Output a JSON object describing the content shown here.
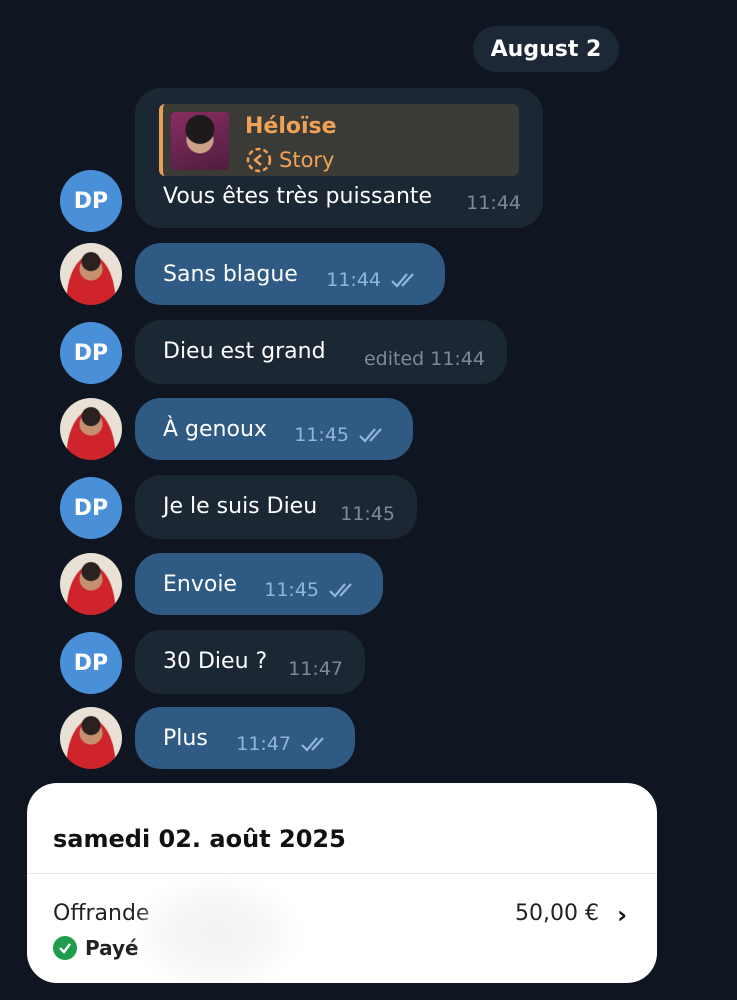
{
  "chat": {
    "date_pill": "August 2",
    "reply": {
      "name": "Héloïse",
      "label": "Story"
    },
    "messages": [
      {
        "sender": "DP",
        "text": "Vous êtes très puissante",
        "time": "11:44",
        "outgoing": false
      },
      {
        "sender": "me",
        "text": "Sans blague",
        "time": "11:44",
        "outgoing": true
      },
      {
        "sender": "DP",
        "text": "Dieu est grand",
        "time": "edited 11:44",
        "outgoing": false
      },
      {
        "sender": "me",
        "text": "À genoux",
        "time": "11:45",
        "outgoing": true
      },
      {
        "sender": "DP",
        "text": "Je le suis Dieu",
        "time": "11:45",
        "outgoing": false
      },
      {
        "sender": "me",
        "text": "Envoie",
        "time": "11:45",
        "outgoing": true
      },
      {
        "sender": "DP",
        "text": "30 Dieu ?",
        "time": "11:47",
        "outgoing": false
      },
      {
        "sender": "me",
        "text": "Plus",
        "time": "11:47",
        "outgoing": true
      }
    ]
  },
  "payment": {
    "date": "samedi 02. août 2025",
    "label": "Offrande",
    "amount": "50,00 €",
    "status": "Payé"
  },
  "colors": {
    "background": "#0f1621",
    "incoming_bubble": "#1c2734",
    "outgoing_bubble": "#2e5a84",
    "avatar_dp": "#4a90d9",
    "reply_accent": "#f0a257",
    "paid_green": "#1f9d4c"
  }
}
